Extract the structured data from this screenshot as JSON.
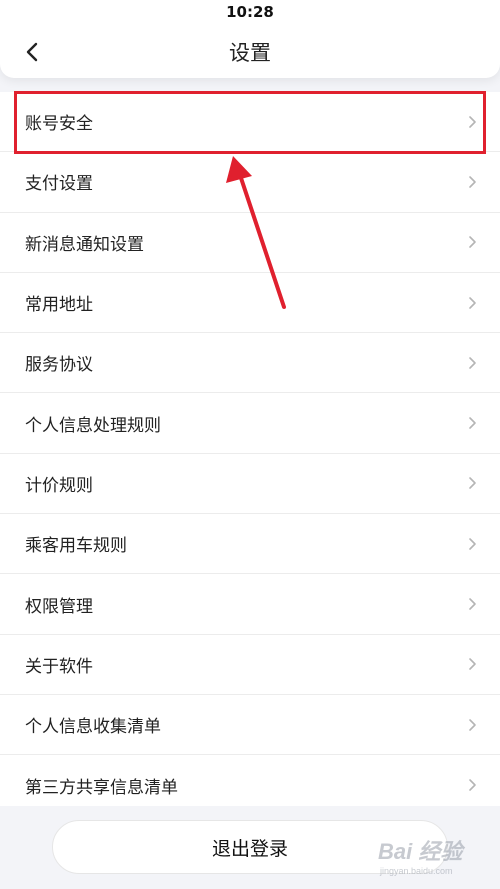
{
  "status_bar": {
    "time": "10:28"
  },
  "header": {
    "title": "设置",
    "back_icon": "chevron-left-icon"
  },
  "menu": {
    "items": [
      {
        "label": "账号安全"
      },
      {
        "label": "支付设置"
      },
      {
        "label": "新消息通知设置"
      },
      {
        "label": "常用地址"
      },
      {
        "label": "服务协议"
      },
      {
        "label": "个人信息处理规则"
      },
      {
        "label": "计价规则"
      },
      {
        "label": "乘客用车规则"
      },
      {
        "label": "权限管理"
      },
      {
        "label": "关于软件"
      },
      {
        "label": "个人信息收集清单"
      },
      {
        "label": "第三方共享信息清单"
      }
    ],
    "chevron_icon": "chevron-right-icon"
  },
  "logout": {
    "label": "退出登录"
  },
  "annotation": {
    "highlight_color": "#e0202e",
    "highlighted_item": "账号安全"
  },
  "watermark": {
    "text": "Bai 经验",
    "subtext": "jingyan.baidu.com"
  },
  "colors": {
    "background": "#f3f4f8",
    "card": "#ffffff",
    "text": "#222222",
    "chevron": "#b5b5b5"
  }
}
